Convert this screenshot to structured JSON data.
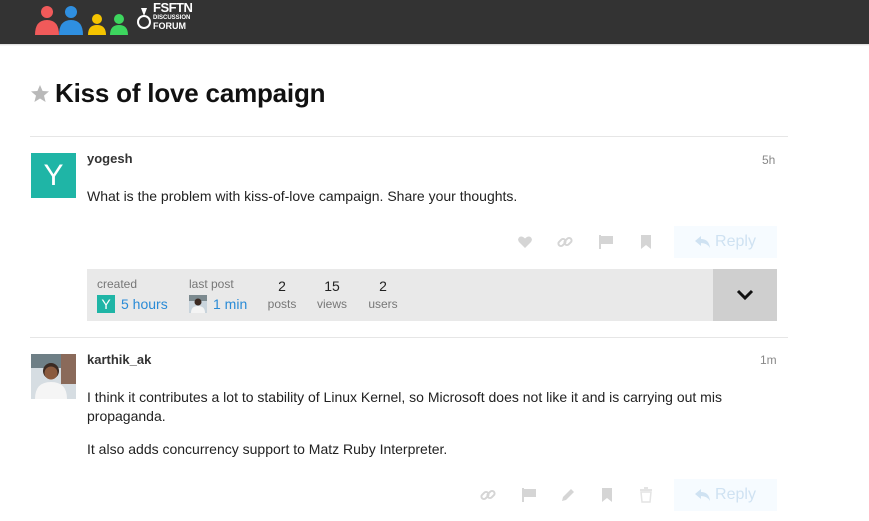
{
  "header": {
    "logo_text_line1": "FSFTN",
    "logo_text_line2": "DISCUSSION",
    "logo_text_line3": "FORUM",
    "colors": {
      "red": "#f05a5a",
      "blue": "#2f8fe0",
      "yellow": "#f5c400",
      "green": "#3dd65e",
      "bar": "#333333"
    }
  },
  "topic": {
    "title": "Kiss of love campaign"
  },
  "posts": [
    {
      "username": "yogesh",
      "avatar_letter": "Y",
      "time": "5h",
      "paragraphs": [
        "What is the problem with kiss-of-love campaign. Share your thoughts."
      ],
      "reply_label": "Reply",
      "actions": [
        "heart-icon",
        "link-icon",
        "flag-icon",
        "bookmark-icon"
      ]
    },
    {
      "username": "karthik_ak",
      "time": "1m",
      "paragraphs": [
        "I think it contributes a lot to stability of Linux Kernel, so Microsoft does not like it and is carrying out mis propaganda.",
        "It also adds concurrency support to Matz Ruby Interpreter."
      ],
      "reply_label": "Reply",
      "actions": [
        "link-icon",
        "flag-icon",
        "pencil-icon",
        "bookmark-icon",
        "trash-icon"
      ]
    }
  ],
  "topic_map": {
    "created_label": "created",
    "created_value": "5 hours",
    "created_avatar_letter": "Y",
    "last_post_label": "last post",
    "last_post_value": "1 min",
    "posts_count": "2",
    "posts_label": "posts",
    "views_count": "15",
    "views_label": "views",
    "users_count": "2",
    "users_label": "users"
  }
}
